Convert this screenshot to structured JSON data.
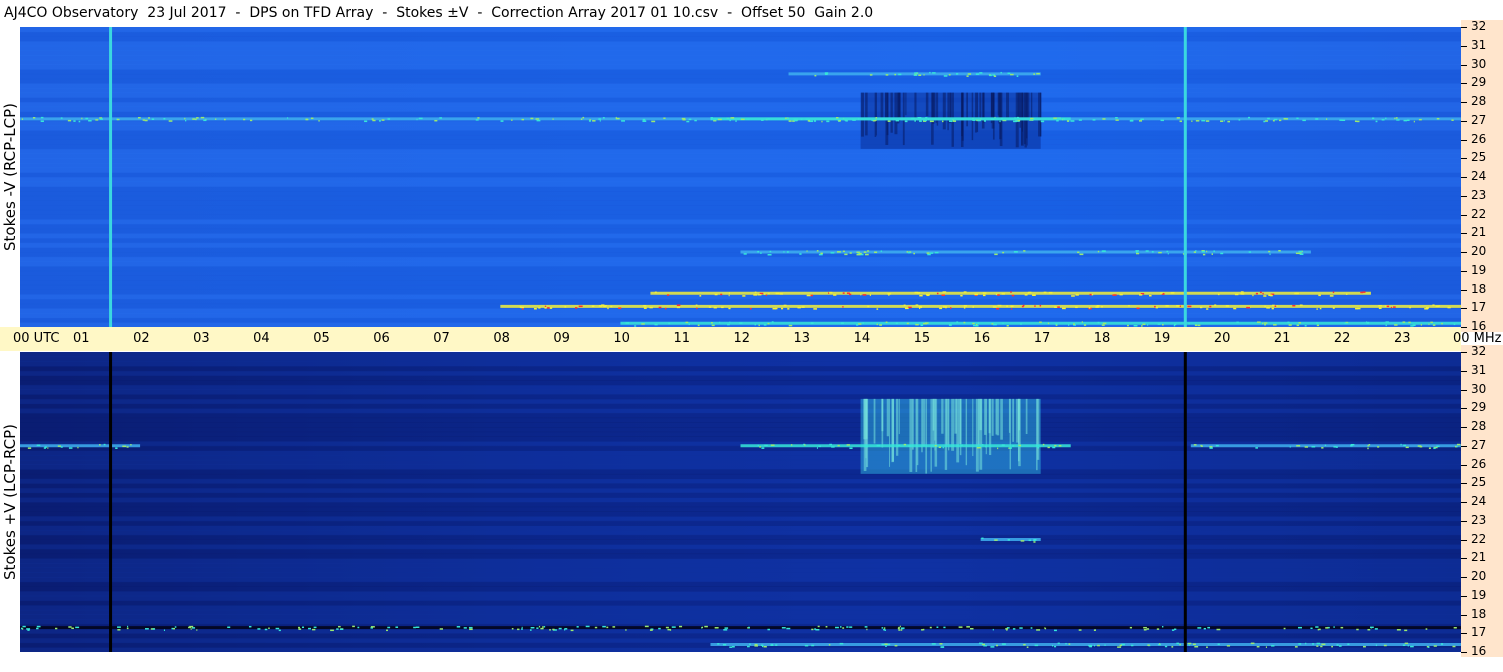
{
  "header": {
    "title": "AJ4CO Observatory  23 Jul 2017  -  DPS on TFD Array  -  Stokes ±V  -  Correction Array 2017 01 10.csv  -  Offset 50  Gain 2.0"
  },
  "panels": {
    "top_label": "Stokes -V (RCP-LCP)",
    "bottom_label": "Stokes +V (LCP-RCP)"
  },
  "time_axis": {
    "labels": [
      "00 UTC",
      "01",
      "02",
      "03",
      "04",
      "05",
      "06",
      "07",
      "08",
      "09",
      "10",
      "11",
      "12",
      "13",
      "14",
      "15",
      "16",
      "17",
      "18",
      "19",
      "20",
      "21",
      "22",
      "23",
      "00 MHz"
    ]
  },
  "freq_axis": {
    "labels": [
      "32",
      "31",
      "30",
      "29",
      "28",
      "27",
      "26",
      "25",
      "24",
      "23",
      "22",
      "21",
      "20",
      "19",
      "18",
      "17",
      "16"
    ]
  },
  "colors": {
    "top_base": "#1e62e6",
    "bottom_base": "#0d2c9a",
    "time_axis_bg": "#fff8c6",
    "freq_axis_bg": "#ffe5cc",
    "highlight_cyan": "#36e6d8",
    "highlight_yellow": "#f2f03a",
    "highlight_red": "#ff3030"
  },
  "chart_data": {
    "type": "heatmap",
    "title": "AJ4CO Observatory  23 Jul 2017  -  DPS on TFD Array  -  Stokes ±V  -  Correction Array 2017 01 10.csv  -  Offset 50  Gain 2.0",
    "x_range_utc_hours": [
      0,
      24
    ],
    "y_range_mhz": [
      16,
      32
    ],
    "panels": [
      {
        "name": "Stokes -V (RCP-LCP)",
        "vertical_lines_utc": [
          1.5,
          19.4
        ],
        "bands": [
          {
            "freq_mhz": 27.1,
            "utc_start": 0.0,
            "utc_end": 24.0,
            "intensity": 0.5
          },
          {
            "freq_mhz": 27.1,
            "utc_start": 11.5,
            "utc_end": 17.5,
            "intensity": 0.9
          },
          {
            "freq_mhz": 29.5,
            "utc_start": 12.8,
            "utc_end": 17.0,
            "intensity": 0.8
          },
          {
            "freq_mhz": 20.0,
            "utc_start": 12.0,
            "utc_end": 21.5,
            "intensity": 0.6
          },
          {
            "freq_mhz": 17.8,
            "utc_start": 10.5,
            "utc_end": 22.5,
            "intensity": 1.0
          },
          {
            "freq_mhz": 17.1,
            "utc_start": 8.0,
            "utc_end": 24.0,
            "intensity": 1.0
          },
          {
            "freq_mhz": 16.2,
            "utc_start": 10.0,
            "utc_end": 24.0,
            "intensity": 0.9
          }
        ],
        "activity_patches": [
          {
            "utc_start": 14.0,
            "utc_end": 17.0,
            "freq_low_mhz": 25.5,
            "freq_high_mhz": 28.5,
            "sign": "dark"
          }
        ]
      },
      {
        "name": "Stokes +V (LCP-RCP)",
        "vertical_lines_utc": [
          1.5,
          19.4
        ],
        "bands": [
          {
            "freq_mhz": 27.0,
            "utc_start": 0.0,
            "utc_end": 2.0,
            "intensity": 0.6
          },
          {
            "freq_mhz": 27.0,
            "utc_start": 12.0,
            "utc_end": 17.5,
            "intensity": 0.9
          },
          {
            "freq_mhz": 27.0,
            "utc_start": 19.5,
            "utc_end": 24.0,
            "intensity": 0.5
          },
          {
            "freq_mhz": 22.0,
            "utc_start": 16.0,
            "utc_end": 17.0,
            "intensity": 0.8
          },
          {
            "freq_mhz": 17.3,
            "utc_start": 0.0,
            "utc_end": 24.0,
            "intensity": -0.8
          },
          {
            "freq_mhz": 16.4,
            "utc_start": 11.5,
            "utc_end": 24.0,
            "intensity": 0.6
          }
        ],
        "activity_patches": [
          {
            "utc_start": 14.0,
            "utc_end": 17.0,
            "freq_low_mhz": 25.5,
            "freq_high_mhz": 29.5,
            "sign": "bright"
          }
        ]
      }
    ]
  }
}
